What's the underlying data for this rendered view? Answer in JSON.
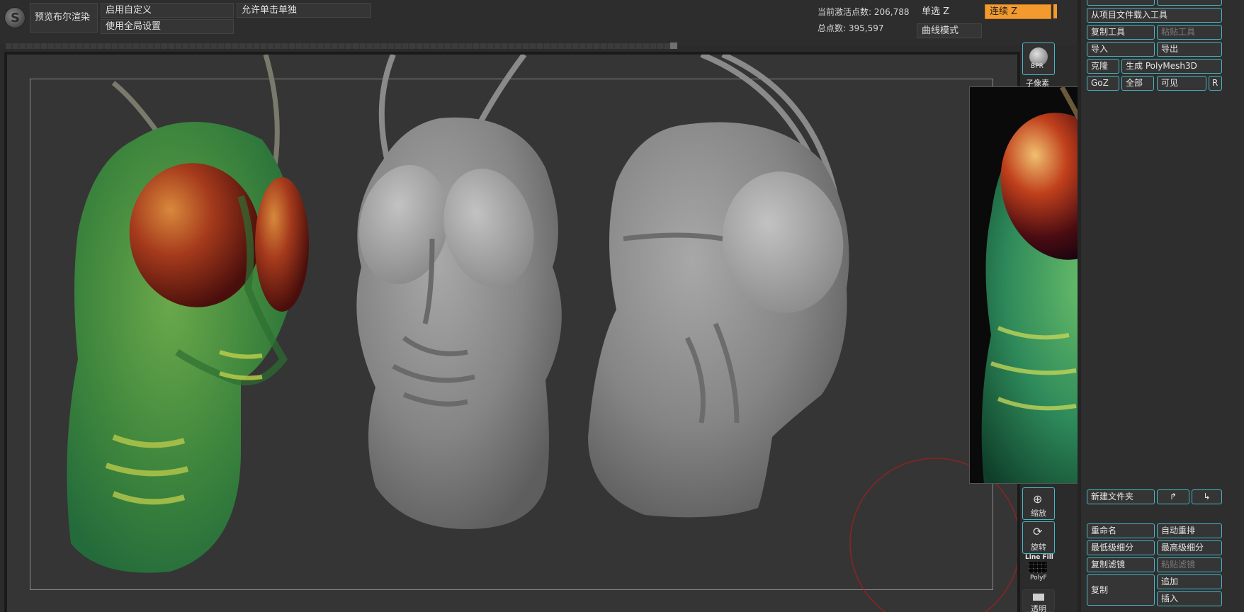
{
  "topbar": {
    "preview_bool_render": "预览布尔渲染",
    "enable_custom": "启用自定义",
    "use_global_settings": "使用全局设置",
    "allow_single_solo": "允许单击单独",
    "active_points_label": "当前激活点数: 206,788",
    "total_points_label": "总点数: 395,597",
    "single_z": "单选 Z",
    "continuous_z": "连续 Z",
    "curve_mode": "曲线模式"
  },
  "vtools": {
    "bpr": "BPR",
    "subpixel": "子像素",
    "zoom": "缩放",
    "rotate": "旋转",
    "line_fill": "Line Fill",
    "polyf": "PolyF",
    "transparent": "透明"
  },
  "panel": {
    "load_from_project": "从项目文件载入工具",
    "copy_tool": "复制工具",
    "paste_tool": "粘贴工具",
    "import": "导入",
    "export": "导出",
    "clone": "克隆",
    "make_polymesh": "生成 PolyMesh3D",
    "goz": "GoZ",
    "all": "全部",
    "visible": "可见",
    "r": "R",
    "new_folder": "新建文件夹",
    "rename": "重命名",
    "auto_reorder": "自动重排",
    "lowest_subdiv": "最低级细分",
    "highest_subdiv": "最高级细分",
    "copy_filter": "复制滤镜",
    "paste_filter": "粘贴滤镜",
    "duplicate": "复制",
    "append": "追加",
    "insert": "插入"
  },
  "colors": {
    "accent": "#f39a2e",
    "panel_border": "#4bb6c4",
    "sculpt_green": "#3f8a3f",
    "sculpt_grey": "#8e8e8e",
    "eye_red": "#a0331c"
  }
}
